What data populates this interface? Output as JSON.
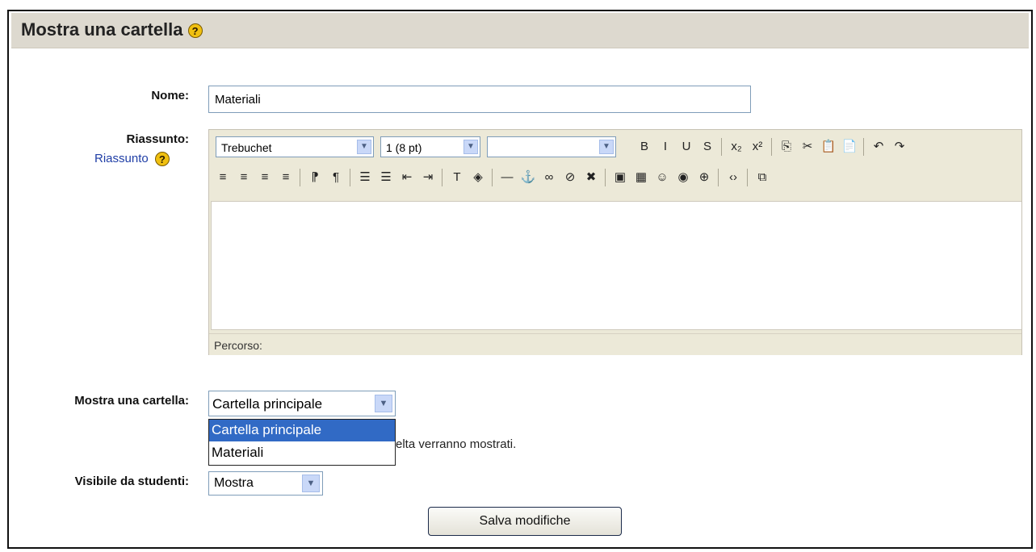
{
  "header": {
    "title": "Mostra una cartella",
    "help_glyph": "?"
  },
  "form": {
    "name_label": "Nome:",
    "name_value": "Materiali",
    "summary_label": "Riassunto:",
    "summary_link": "Riassunto",
    "help_glyph": "?",
    "folder_label": "Mostra una cartella:",
    "visible_label": "Visibile da studenti:"
  },
  "editor": {
    "font_family": "Trebuchet",
    "font_size": "1 (8 pt)",
    "format_value": "",
    "toolbar1": [
      "B",
      "I",
      "U",
      "S",
      "x₂",
      "x²",
      "⎘",
      "✂",
      "📋",
      "📄",
      "↶",
      "↷"
    ],
    "toolbar2": [
      "≡",
      "≡",
      "≡",
      "≡",
      "⁋",
      "¶",
      "☰",
      "☰",
      "⇤",
      "⇥",
      "T",
      "◈",
      "—",
      "⚓",
      "∞",
      "⊘",
      "✖",
      "▣",
      "▦",
      "☺",
      "◉",
      "⊕",
      "‹›",
      "⧉"
    ],
    "path_label": "Percorso:"
  },
  "folder_dropdown": {
    "selected": "Cartella principale",
    "options": [
      "Cartella principale",
      "Materiali"
    ]
  },
  "hint_text": "elta verranno mostrati.",
  "visible_dropdown": {
    "selected": "Mostra"
  },
  "save_button": "Salva modifiche",
  "colors": {
    "header_bg": "#ddd9cf",
    "selected_option": "#316ac5",
    "link": "#1f3ea6",
    "toolbar_bg": "#ece9d8"
  }
}
